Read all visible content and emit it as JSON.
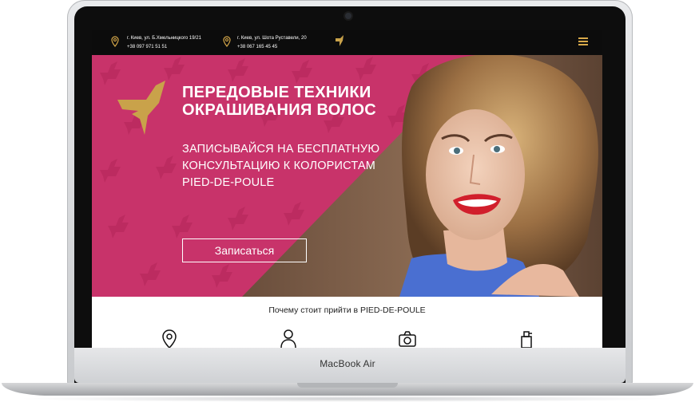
{
  "laptop": {
    "brand_label": "MacBook Air"
  },
  "header": {
    "locations": [
      {
        "address": "г. Киев, ул. Б.Хмельницкого 19/21",
        "phone": "+38 097 971 51 51"
      },
      {
        "address": "г. Киев, ул. Шота Руставели, 20",
        "phone": "+38 067 165 45 45"
      }
    ],
    "menu_icon": "hamburger-icon",
    "accent_color": "#d8a94a"
  },
  "hero": {
    "title_line1": "Передовые техники",
    "title_line2": "окрашивания волос",
    "subtitle_line1": "ЗАПИСЫВАЙСЯ НА БЕСПЛАТНУЮ",
    "subtitle_line2": "КОНСУЛЬТАЦИЮ К КОЛОРИСТАМ",
    "subtitle_line3": "PIED-DE-POULE",
    "cta_label": "Записаться",
    "background_color": "#c8336a",
    "logo_color": "#c9a24a"
  },
  "why": {
    "title": "Почему стоит прийти в PIED-DE-POULE",
    "icons": [
      "location-pin-icon",
      "person-icon",
      "camera-icon",
      "spray-bottle-icon"
    ]
  }
}
